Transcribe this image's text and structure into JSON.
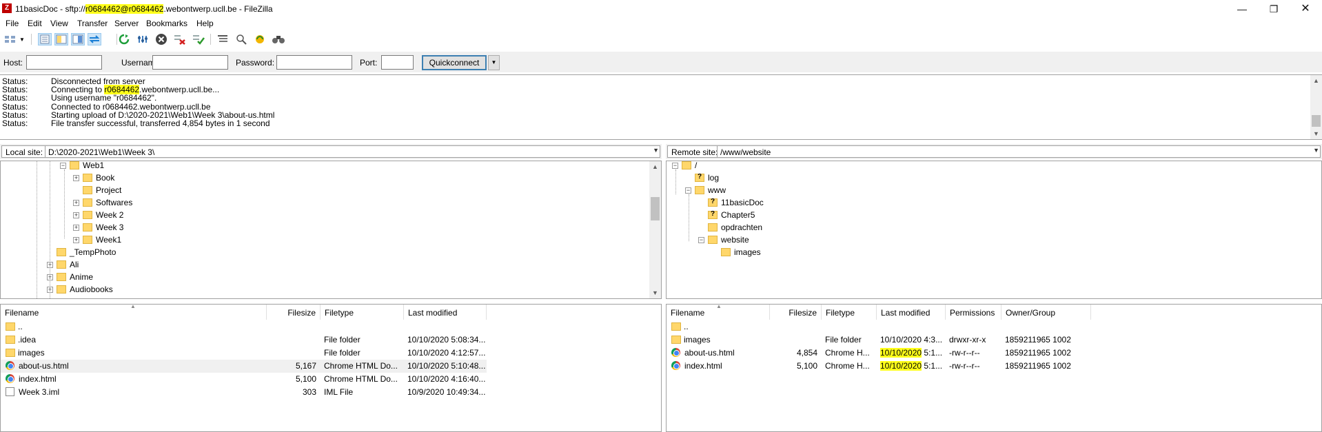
{
  "window": {
    "title_prefix": "11basicDoc - sftp://",
    "title_highlight": "r0684462@r0684462",
    "title_suffix": ".webontwerp.ucll.be - FileZilla",
    "app_icon_letter": "Z"
  },
  "menu": [
    "File",
    "Edit",
    "View",
    "Transfer",
    "Server",
    "Bookmarks",
    "Help"
  ],
  "quickconnect": {
    "host_label": "Host:",
    "username_label": "Username:",
    "password_label": "Password:",
    "port_label": "Port:",
    "host_value": "",
    "username_value": "",
    "password_value": "",
    "port_value": "",
    "button_label": "Quickconnect"
  },
  "log": [
    {
      "label": "Status:",
      "pre": "Disconnected from server",
      "hl": "",
      "post": ""
    },
    {
      "label": "Status:",
      "pre": "Connecting to ",
      "hl": "r0684462",
      "post": ".webontwerp.ucll.be..."
    },
    {
      "label": "Status:",
      "pre": "Using username \"r0684462\".",
      "hl": "",
      "post": ""
    },
    {
      "label": "Status:",
      "pre": "Connected to r0684462.webontwerp.ucll.be",
      "hl": "",
      "post": ""
    },
    {
      "label": "Status:",
      "pre": "Starting upload of D:\\2020-2021\\Web1\\Week 3\\about-us.html",
      "hl": "",
      "post": ""
    },
    {
      "label": "Status:",
      "pre": "File transfer successful, transferred 4,854 bytes in 1 second",
      "hl": "",
      "post": ""
    }
  ],
  "local": {
    "site_label": "Local site:",
    "path": "D:\\2020-2021\\Web1\\Week 3\\",
    "tree": [
      {
        "name": "Web1",
        "indent": 2,
        "expander": "minus",
        "unknown": false
      },
      {
        "name": "Book",
        "indent": 3,
        "expander": "plus",
        "unknown": false
      },
      {
        "name": "Project",
        "indent": 3,
        "expander": "",
        "unknown": false
      },
      {
        "name": "Softwares",
        "indent": 3,
        "expander": "plus",
        "unknown": false
      },
      {
        "name": "Week 2",
        "indent": 3,
        "expander": "plus",
        "unknown": false
      },
      {
        "name": "Week 3",
        "indent": 3,
        "expander": "plus",
        "unknown": false
      },
      {
        "name": "Week1",
        "indent": 3,
        "expander": "plus",
        "unknown": false
      },
      {
        "name": "_TempPhoto",
        "indent": 1,
        "expander": "",
        "unknown": false
      },
      {
        "name": "Ali",
        "indent": 1,
        "expander": "plus",
        "unknown": false
      },
      {
        "name": "Anime",
        "indent": 1,
        "expander": "plus",
        "unknown": false
      },
      {
        "name": "Audiobooks",
        "indent": 1,
        "expander": "plus",
        "unknown": false
      }
    ],
    "columns": [
      "Filename",
      "Filesize",
      "Filetype",
      "Last modified"
    ],
    "files": [
      {
        "name": "..",
        "size": "",
        "type": "",
        "modified": "",
        "icon": "folder"
      },
      {
        "name": ".idea",
        "size": "",
        "type": "File folder",
        "modified": "10/10/2020 5:08:34...",
        "icon": "folder"
      },
      {
        "name": "images",
        "size": "",
        "type": "File folder",
        "modified": "10/10/2020 4:12:57...",
        "icon": "folder"
      },
      {
        "name": "about-us.html",
        "size": "5,167",
        "type": "Chrome HTML Do...",
        "modified": "10/10/2020 5:10:48...",
        "icon": "chrome"
      },
      {
        "name": "index.html",
        "size": "5,100",
        "type": "Chrome HTML Do...",
        "modified": "10/10/2020 4:16:40...",
        "icon": "chrome"
      },
      {
        "name": "Week 3.iml",
        "size": "303",
        "type": "IML File",
        "modified": "10/9/2020 10:49:34...",
        "icon": "doc"
      }
    ]
  },
  "remote": {
    "site_label": "Remote site:",
    "path": "/www/website",
    "tree": [
      {
        "name": "/",
        "indent": 0,
        "expander": "minus",
        "unknown": false
      },
      {
        "name": "log",
        "indent": 1,
        "expander": "",
        "unknown": true
      },
      {
        "name": "www",
        "indent": 1,
        "expander": "minus",
        "unknown": false
      },
      {
        "name": "11basicDoc",
        "indent": 2,
        "expander": "",
        "unknown": true
      },
      {
        "name": "Chapter5",
        "indent": 2,
        "expander": "",
        "unknown": true
      },
      {
        "name": "opdrachten",
        "indent": 2,
        "expander": "",
        "unknown": false
      },
      {
        "name": "website",
        "indent": 2,
        "expander": "minus",
        "unknown": false
      },
      {
        "name": "images",
        "indent": 3,
        "expander": "",
        "unknown": false
      }
    ],
    "columns": [
      "Filename",
      "Filesize",
      "Filetype",
      "Last modified",
      "Permissions",
      "Owner/Group"
    ],
    "files": [
      {
        "name": "..",
        "size": "",
        "type": "",
        "modified_hl": "",
        "modified": "",
        "perms": "",
        "owner": "",
        "icon": "folder"
      },
      {
        "name": "images",
        "size": "",
        "type": "File folder",
        "modified_hl": "",
        "modified": "10/10/2020 4:3...",
        "perms": "drwxr-xr-x",
        "owner": "1859211965 1002",
        "icon": "folder"
      },
      {
        "name": "about-us.html",
        "size": "4,854",
        "type": "Chrome H...",
        "modified_hl": "10/10/2020",
        "modified": " 5:1...",
        "perms": "-rw-r--r--",
        "owner": "1859211965 1002",
        "icon": "chrome"
      },
      {
        "name": "index.html",
        "size": "5,100",
        "type": "Chrome H...",
        "modified_hl": "10/10/2020",
        "modified": " 5:1...",
        "perms": "-rw-r--r--",
        "owner": "1859211965 1002",
        "icon": "chrome"
      }
    ]
  },
  "colors": {
    "highlight": "#ffff1a",
    "folder": "#ffd76b",
    "quickconnect_border": "#3c7fb1"
  }
}
